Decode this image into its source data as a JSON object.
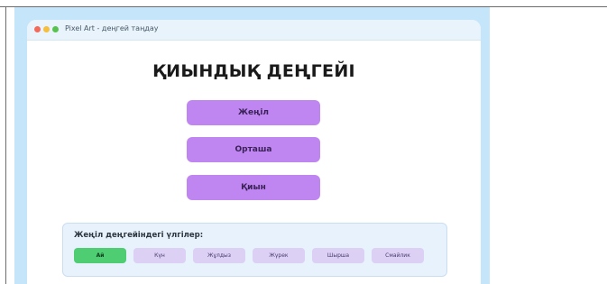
{
  "window": {
    "title": "Pixel Art - деңгей таңдау"
  },
  "heading": "ҚИЫНДЫҚ ДЕҢГЕЙІ",
  "difficulty_buttons": [
    {
      "label": "Жеңіл"
    },
    {
      "label": "Орташа"
    },
    {
      "label": "Қиын"
    }
  ],
  "patterns": {
    "title": "Жеңіл деңгейіндегі үлгілер:",
    "items": [
      {
        "label": "Ай",
        "active": true
      },
      {
        "label": "Күн",
        "active": false
      },
      {
        "label": "Жұлдыз",
        "active": false
      },
      {
        "label": "Жүрек",
        "active": false
      },
      {
        "label": "Шырша",
        "active": false
      },
      {
        "label": "Смайлик",
        "active": false
      }
    ]
  },
  "colors": {
    "background": "#c5e5fa",
    "button": "#bf86f2",
    "active_chip": "#4fcd72",
    "chip": "#dcd0f5"
  }
}
